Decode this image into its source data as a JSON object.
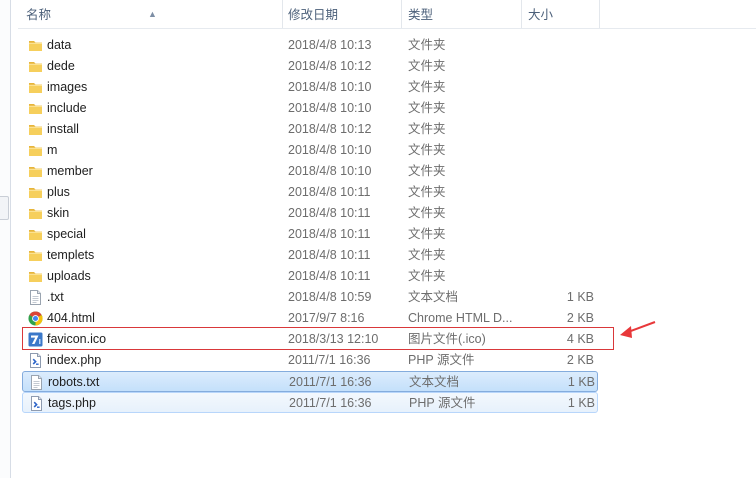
{
  "columns": {
    "name": "名称",
    "date": "修改日期",
    "type": "类型",
    "size": "大小"
  },
  "colors": {
    "folder": "#f2c24b",
    "selection": "#cce4fb",
    "highlight_border": "#d9383a",
    "arrow": "#e8383a"
  },
  "files": [
    {
      "name": "data",
      "date": "2018/4/8 10:13",
      "type": "文件夹",
      "size": "",
      "icon": "folder-icon"
    },
    {
      "name": "dede",
      "date": "2018/4/8 10:12",
      "type": "文件夹",
      "size": "",
      "icon": "folder-icon"
    },
    {
      "name": "images",
      "date": "2018/4/8 10:10",
      "type": "文件夹",
      "size": "",
      "icon": "folder-icon"
    },
    {
      "name": "include",
      "date": "2018/4/8 10:10",
      "type": "文件夹",
      "size": "",
      "icon": "folder-icon"
    },
    {
      "name": "install",
      "date": "2018/4/8 10:12",
      "type": "文件夹",
      "size": "",
      "icon": "folder-icon"
    },
    {
      "name": "m",
      "date": "2018/4/8 10:10",
      "type": "文件夹",
      "size": "",
      "icon": "folder-icon"
    },
    {
      "name": "member",
      "date": "2018/4/8 10:10",
      "type": "文件夹",
      "size": "",
      "icon": "folder-icon"
    },
    {
      "name": "plus",
      "date": "2018/4/8 10:11",
      "type": "文件夹",
      "size": "",
      "icon": "folder-icon"
    },
    {
      "name": "skin",
      "date": "2018/4/8 10:11",
      "type": "文件夹",
      "size": "",
      "icon": "folder-icon"
    },
    {
      "name": "special",
      "date": "2018/4/8 10:11",
      "type": "文件夹",
      "size": "",
      "icon": "folder-icon"
    },
    {
      "name": "templets",
      "date": "2018/4/8 10:11",
      "type": "文件夹",
      "size": "",
      "icon": "folder-icon"
    },
    {
      "name": "uploads",
      "date": "2018/4/8 10:11",
      "type": "文件夹",
      "size": "",
      "icon": "folder-icon"
    },
    {
      "name": ".txt",
      "date": "2018/4/8 10:59",
      "type": "文本文档",
      "size": "1 KB",
      "icon": "text-file-icon"
    },
    {
      "name": "404.html",
      "date": "2017/9/7 8:16",
      "type": "Chrome HTML D...",
      "size": "2 KB",
      "icon": "chrome-icon"
    },
    {
      "name": "favicon.ico",
      "date": "2018/3/13 12:10",
      "type": "图片文件(.ico)",
      "size": "4 KB",
      "icon": "ico-image-icon"
    },
    {
      "name": "index.php",
      "date": "2011/7/1 16:36",
      "type": "PHP 源文件",
      "size": "2 KB",
      "icon": "php-file-icon"
    },
    {
      "name": "robots.txt",
      "date": "2011/7/1 16:36",
      "type": "文本文档",
      "size": "1 KB",
      "icon": "text-file-icon"
    },
    {
      "name": "tags.php",
      "date": "2011/7/1 16:36",
      "type": "PHP 源文件",
      "size": "1 KB",
      "icon": "php-file-icon"
    }
  ]
}
